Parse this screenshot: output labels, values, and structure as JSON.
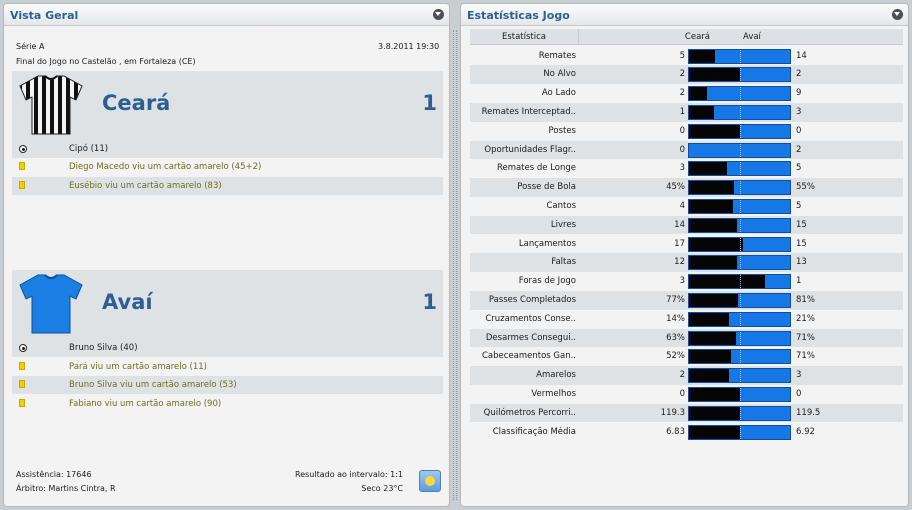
{
  "overview": {
    "title": "Vista Geral",
    "competition": "Série A",
    "datetime": "3.8.2011 19:30",
    "venue": "Final do Jogo no Castelão , em Fortaleza (CE)",
    "home": {
      "name": "Ceará",
      "score": "1",
      "events": [
        {
          "icon": "goal-ball-icon",
          "text": "Cipó (11)"
        },
        {
          "icon": "yellow-card-icon",
          "text": "Diego Macedo viu um cartão amarelo (45+2)"
        },
        {
          "icon": "yellow-card-icon",
          "text": "Eusébio viu um cartão amarelo (83)"
        }
      ]
    },
    "away": {
      "name": "Avaí",
      "score": "1",
      "events": [
        {
          "icon": "goal-ball-icon",
          "text": "Bruno Silva (40)"
        },
        {
          "icon": "yellow-card-icon",
          "text": "Pará viu um cartão amarelo (11)"
        },
        {
          "icon": "yellow-card-icon",
          "text": "Bruno Silva viu um cartão amarelo (53)"
        },
        {
          "icon": "yellow-card-icon",
          "text": "Fabiano viu um cartão amarelo (90)"
        }
      ]
    },
    "attendance": "Assistência: 17646",
    "referee": "Árbitro: Martins Cintra, R",
    "halftime": "Resultado ao intervalo: 1:1",
    "weather": "Seco 23°C"
  },
  "stats": {
    "title": "Estatísticas Jogo",
    "column_label": "Estatística",
    "home_label": "Ceará",
    "away_label": "Avaí",
    "rows": [
      {
        "label": "Remates",
        "home": "5",
        "away": "14",
        "home_share": 0.26
      },
      {
        "label": "No Alvo",
        "home": "2",
        "away": "2",
        "home_share": 0.5
      },
      {
        "label": "Ao Lado",
        "home": "2",
        "away": "9",
        "home_share": 0.18
      },
      {
        "label": "Remates Interceptad..",
        "home": "1",
        "away": "3",
        "home_share": 0.25
      },
      {
        "label": "Postes",
        "home": "0",
        "away": "0",
        "home_share": 0.5
      },
      {
        "label": "Oportunidades Flagr..",
        "home": "0",
        "away": "2",
        "home_share": 0.0
      },
      {
        "label": "Remates de Longe",
        "home": "3",
        "away": "5",
        "home_share": 0.38
      },
      {
        "label": "Posse de Bola",
        "home": "45%",
        "away": "55%",
        "home_share": 0.45
      },
      {
        "label": "Cantos",
        "home": "4",
        "away": "5",
        "home_share": 0.44
      },
      {
        "label": "Livres",
        "home": "14",
        "away": "15",
        "home_share": 0.48
      },
      {
        "label": "Lançamentos",
        "home": "17",
        "away": "15",
        "home_share": 0.53
      },
      {
        "label": "Faltas",
        "home": "12",
        "away": "13",
        "home_share": 0.48
      },
      {
        "label": "Foras de Jogo",
        "home": "3",
        "away": "1",
        "home_share": 0.75
      },
      {
        "label": "Passes Completados",
        "home": "77%",
        "away": "81%",
        "home_share": 0.49
      },
      {
        "label": "Cruzamentos Conse..",
        "home": "14%",
        "away": "21%",
        "home_share": 0.4
      },
      {
        "label": "Desarmes Consegui..",
        "home": "63%",
        "away": "71%",
        "home_share": 0.47
      },
      {
        "label": "Cabeceamentos Gan..",
        "home": "52%",
        "away": "71%",
        "home_share": 0.42
      },
      {
        "label": "Amarelos",
        "home": "2",
        "away": "3",
        "home_share": 0.4
      },
      {
        "label": "Vermelhos",
        "home": "0",
        "away": "0",
        "home_share": 0.5
      },
      {
        "label": "Quilómetros Percorri..",
        "home": "119.3",
        "away": "119.5",
        "home_share": 0.5
      },
      {
        "label": "Classificação Média",
        "home": "6.83",
        "away": "6.92",
        "home_share": 0.5
      }
    ]
  },
  "colors": {
    "accent": "#2d5f95",
    "home_bar": "#050505",
    "away_bar": "#1677e6",
    "card_text": "#6d6c1f",
    "home_shirt": "black-white-stripes",
    "away_shirt": "#1a7fe3"
  }
}
